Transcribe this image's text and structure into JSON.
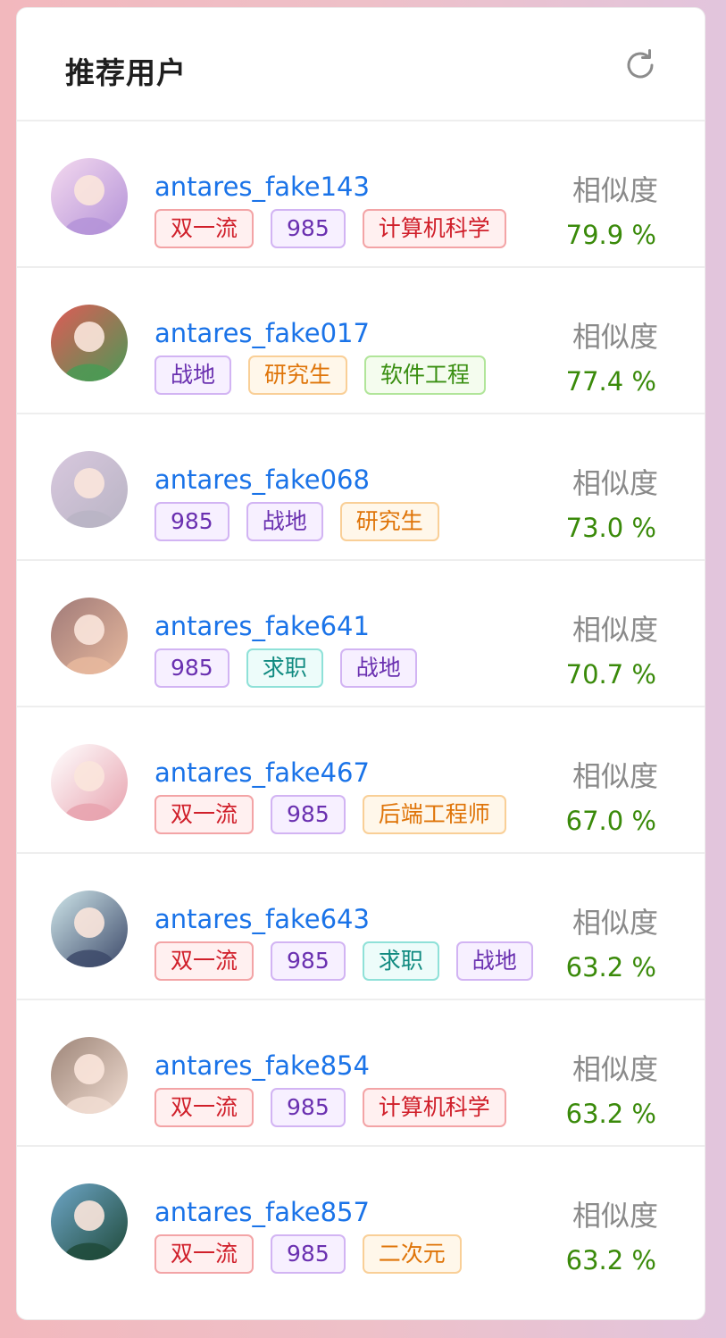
{
  "card": {
    "title": "推荐用户",
    "refresh_icon": "refresh-icon"
  },
  "tag_styles": {
    "red": {
      "border": "#f3a4a6",
      "bg": "#fff0f0",
      "color": "#d01f2a"
    },
    "purple": {
      "border": "#d2b4f3",
      "bg": "#f7f0ff",
      "color": "#6a30b0"
    },
    "orange": {
      "border": "#f9cf97",
      "bg": "#fff7ea",
      "color": "#df7408"
    },
    "green": {
      "border": "#b1e59a",
      "bg": "#f4fcee",
      "color": "#3a8f12"
    },
    "cyan": {
      "border": "#8fe1d8",
      "bg": "#edfcfa",
      "color": "#108a80"
    }
  },
  "users": [
    {
      "username": "antares_fake143",
      "avatar": "avatar-icon",
      "avatar_colors": [
        "#f4d9ef",
        "#b493d8"
      ],
      "sim_label": "相似度",
      "similarity": "79.9 %",
      "tags": [
        {
          "label": "双一流",
          "style": "red"
        },
        {
          "label": "985",
          "style": "purple"
        },
        {
          "label": "计算机科学",
          "style": "red"
        }
      ]
    },
    {
      "username": "antares_fake017",
      "avatar": "avatar-icon",
      "avatar_colors": [
        "#e05a57",
        "#4a9a55"
      ],
      "sim_label": "相似度",
      "similarity": "77.4 %",
      "tags": [
        {
          "label": "战地",
          "style": "purple"
        },
        {
          "label": "研究生",
          "style": "orange"
        },
        {
          "label": "软件工程",
          "style": "green"
        }
      ]
    },
    {
      "username": "antares_fake068",
      "avatar": "avatar-icon",
      "avatar_colors": [
        "#d8c8de",
        "#b9b4c4"
      ],
      "sim_label": "相似度",
      "similarity": "73.0 %",
      "tags": [
        {
          "label": "985",
          "style": "purple"
        },
        {
          "label": "战地",
          "style": "purple"
        },
        {
          "label": "研究生",
          "style": "orange"
        }
      ]
    },
    {
      "username": "antares_fake641",
      "avatar": "avatar-icon",
      "avatar_colors": [
        "#a07a78",
        "#e7b99e"
      ],
      "sim_label": "相似度",
      "similarity": "70.7 %",
      "tags": [
        {
          "label": "985",
          "style": "purple"
        },
        {
          "label": "求职",
          "style": "cyan"
        },
        {
          "label": "战地",
          "style": "purple"
        }
      ]
    },
    {
      "username": "antares_fake467",
      "avatar": "avatar-icon",
      "avatar_colors": [
        "#ffffff",
        "#e7a2ae"
      ],
      "sim_label": "相似度",
      "similarity": "67.0 %",
      "tags": [
        {
          "label": "双一流",
          "style": "red"
        },
        {
          "label": "985",
          "style": "purple"
        },
        {
          "label": "后端工程师",
          "style": "orange"
        }
      ]
    },
    {
      "username": "antares_fake643",
      "avatar": "avatar-icon",
      "avatar_colors": [
        "#cfe6ea",
        "#3d4a6a"
      ],
      "sim_label": "相似度",
      "similarity": "63.2 %",
      "tags": [
        {
          "label": "双一流",
          "style": "red"
        },
        {
          "label": "985",
          "style": "purple"
        },
        {
          "label": "求职",
          "style": "cyan"
        },
        {
          "label": "战地",
          "style": "purple"
        }
      ]
    },
    {
      "username": "antares_fake854",
      "avatar": "avatar-icon",
      "avatar_colors": [
        "#9d8578",
        "#f1ddd2"
      ],
      "sim_label": "相似度",
      "similarity": "63.2 %",
      "tags": [
        {
          "label": "双一流",
          "style": "red"
        },
        {
          "label": "985",
          "style": "purple"
        },
        {
          "label": "计算机科学",
          "style": "red"
        }
      ]
    },
    {
      "username": "antares_fake857",
      "avatar": "avatar-icon",
      "avatar_colors": [
        "#6ea6c8",
        "#1f4a3a"
      ],
      "sim_label": "相似度",
      "similarity": "63.2 %",
      "tags": [
        {
          "label": "双一流",
          "style": "red"
        },
        {
          "label": "985",
          "style": "purple"
        },
        {
          "label": "二次元",
          "style": "orange"
        }
      ]
    }
  ]
}
